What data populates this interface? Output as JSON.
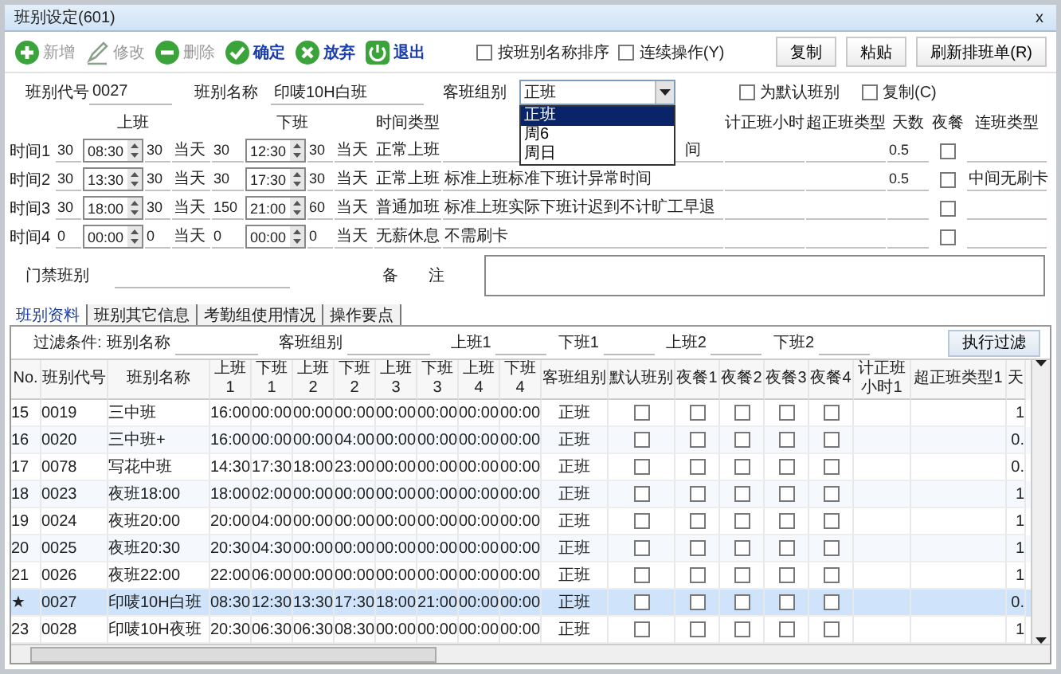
{
  "window": {
    "title": "班别设定(601)",
    "close": "x"
  },
  "toolbar": [
    {
      "kind": "add",
      "label": "新增",
      "disabled": true
    },
    {
      "kind": "edit",
      "label": "修改",
      "disabled": true
    },
    {
      "kind": "delete",
      "label": "删除",
      "disabled": true
    },
    {
      "kind": "ok",
      "label": "确定",
      "disabled": false
    },
    {
      "kind": "cancel",
      "label": "放弃",
      "disabled": false
    },
    {
      "kind": "exit",
      "label": "退出",
      "disabled": false
    }
  ],
  "options": [
    {
      "label": "按班别名称排序",
      "checked": false
    },
    {
      "label": "连续操作(Y)",
      "checked": false
    }
  ],
  "actions": [
    "复制",
    "粘贴",
    "刷新排班单(R)"
  ],
  "form": {
    "code_label": "班别代号",
    "code": "0027",
    "name_label": "班别名称",
    "name": "印唛10H白班",
    "group_label": "客班组别",
    "group": "正班",
    "group_options": [
      {
        "label": "正班",
        "selected": true
      },
      {
        "label": "周6",
        "selected": false
      },
      {
        "label": "周日",
        "selected": false
      }
    ],
    "flags": [
      {
        "label": "为默认班别",
        "checked": false
      },
      {
        "label": "复制(C)",
        "checked": false
      }
    ],
    "headers": {
      "on": "上班",
      "off": "下班",
      "type": "时间类型",
      "hours": "计正班小时",
      "over": "超正班类型",
      "days": "天数",
      "meal": "夜餐",
      "link": "连班类型"
    },
    "times": [
      {
        "label": "时间1",
        "on_before": "30",
        "on": "08:30",
        "on_after": "30",
        "on_day": "当天",
        "off_before": "30",
        "off": "12:30",
        "off_after": "30",
        "off_day": "当天",
        "type": "正常上班",
        "description": "间",
        "days": "0.5",
        "meal": false
      },
      {
        "label": "时间2",
        "on_before": "30",
        "on": "13:30",
        "on_after": "30",
        "on_day": "当天",
        "off_before": "30",
        "off": "17:30",
        "off_after": "30",
        "off_day": "当天",
        "type": "正常上班",
        "description": "标准上班标准下班计异常时间",
        "days": "0.5",
        "meal": false,
        "link": "中间无刷卡"
      },
      {
        "label": "时间3",
        "on_before": "30",
        "on": "18:00",
        "on_after": "30",
        "on_day": "当天",
        "off_before": "150",
        "off": "21:00",
        "off_after": "60",
        "off_day": "当天",
        "type": "普通加班",
        "description": "标准上班实际下班计迟到不计旷工早退",
        "meal": false
      },
      {
        "label": "时间4",
        "on_before": "0",
        "on": "00:00",
        "on_after": "0",
        "on_day": "当天",
        "off_before": "0",
        "off": "00:00",
        "off_after": "0",
        "off_day": "当天",
        "type": "无薪休息",
        "description": "不需刷卡",
        "meal": false
      }
    ],
    "door_label": "门禁班别",
    "remarks_label": "备 注"
  },
  "tabs": [
    {
      "label": "班别资料",
      "selected": true
    },
    {
      "label": "班别其它信息",
      "selected": false
    },
    {
      "label": "考勤组使用情况",
      "selected": false
    },
    {
      "label": "操作要点",
      "selected": false
    }
  ],
  "filter": {
    "title": "过滤条件:",
    "fields": [
      "班别名称",
      "客班组别",
      "上班1",
      "下班1",
      "上班2",
      "下班2"
    ],
    "button": "执行过滤"
  },
  "table": {
    "columns": [
      "No.",
      "班别代号",
      "班别名称",
      "上班1",
      "下班1",
      "上班2",
      "下班2",
      "上班3",
      "下班3",
      "上班4",
      "下班4",
      "客班组别",
      "默认班别",
      "夜餐1",
      "夜餐2",
      "夜餐3",
      "夜餐4",
      "计正班小时1",
      "超正班类型1",
      "天"
    ],
    "rows": [
      {
        "no": "15",
        "code": "0019",
        "name": "三中班",
        "times": [
          "16:00",
          "00:00",
          "00:00",
          "00:00",
          "00:00",
          "00:00",
          "00:00",
          "00:00"
        ],
        "group": "正班",
        "default": false,
        "meals": [
          false,
          false,
          false,
          false
        ],
        "days": "1",
        "selected": false
      },
      {
        "no": "16",
        "code": "0020",
        "name": "三中班+",
        "times": [
          "16:00",
          "00:00",
          "00:00",
          "04:00",
          "00:00",
          "00:00",
          "00:00",
          "00:00"
        ],
        "group": "正班",
        "default": false,
        "meals": [
          false,
          false,
          false,
          false
        ],
        "days": "0.",
        "selected": false
      },
      {
        "no": "17",
        "code": "0078",
        "name": "写花中班",
        "times": [
          "14:30",
          "17:30",
          "18:00",
          "23:00",
          "00:00",
          "00:00",
          "00:00",
          "00:00"
        ],
        "group": "正班",
        "default": false,
        "meals": [
          false,
          false,
          false,
          false
        ],
        "days": "0.",
        "selected": false
      },
      {
        "no": "18",
        "code": "0023",
        "name": "夜班18:00",
        "times": [
          "18:00",
          "02:00",
          "00:00",
          "00:00",
          "00:00",
          "00:00",
          "00:00",
          "00:00"
        ],
        "group": "正班",
        "default": false,
        "meals": [
          false,
          false,
          false,
          false
        ],
        "days": "1",
        "selected": false
      },
      {
        "no": "19",
        "code": "0024",
        "name": "夜班20:00",
        "times": [
          "20:00",
          "04:00",
          "00:00",
          "00:00",
          "00:00",
          "00:00",
          "00:00",
          "00:00"
        ],
        "group": "正班",
        "default": false,
        "meals": [
          false,
          false,
          false,
          false
        ],
        "days": "1",
        "selected": false
      },
      {
        "no": "20",
        "code": "0025",
        "name": "夜班20:30",
        "times": [
          "20:30",
          "04:30",
          "00:00",
          "00:00",
          "00:00",
          "00:00",
          "00:00",
          "00:00"
        ],
        "group": "正班",
        "default": false,
        "meals": [
          false,
          false,
          false,
          false
        ],
        "days": "1",
        "selected": false
      },
      {
        "no": "21",
        "code": "0026",
        "name": "夜班22:00",
        "times": [
          "22:00",
          "06:00",
          "00:00",
          "00:00",
          "00:00",
          "00:00",
          "00:00",
          "00:00"
        ],
        "group": "正班",
        "default": false,
        "meals": [
          false,
          false,
          false,
          false
        ],
        "days": "1",
        "selected": false
      },
      {
        "no": "★",
        "code": "0027",
        "name": "印唛10H白班",
        "times": [
          "08:30",
          "12:30",
          "13:30",
          "17:30",
          "18:00",
          "21:00",
          "00:00",
          "00:00"
        ],
        "group": "正班",
        "default": false,
        "meals": [
          false,
          false,
          false,
          false
        ],
        "days": "0.",
        "selected": true
      },
      {
        "no": "23",
        "code": "0028",
        "name": "印唛10H夜班",
        "times": [
          "20:30",
          "06:30",
          "06:30",
          "08:30",
          "00:00",
          "00:00",
          "00:00",
          "00:00"
        ],
        "group": "正班",
        "default": false,
        "meals": [
          false,
          false,
          false,
          false
        ],
        "days": "1",
        "selected": false
      }
    ]
  }
}
